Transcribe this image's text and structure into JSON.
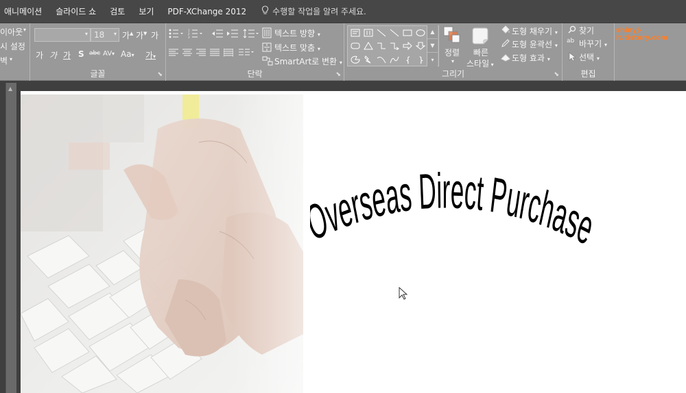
{
  "menubar": {
    "tabs": [
      "애니메이션",
      "슬라이드 쇼",
      "검토",
      "보기",
      "PDF-XChange 2012"
    ],
    "tell_me": "수행할 작업을 알려 주세요."
  },
  "ribbon": {
    "layout_partial": {
      "items": [
        "이아웃",
        "시 설정",
        "벽"
      ]
    },
    "font": {
      "label": "글꼴",
      "size": "18",
      "grow": "가",
      "shrink": "가",
      "clear": "가",
      "bold": "가",
      "italic": "가",
      "underline": "가",
      "shadow": "S",
      "strike": "abc",
      "spacing": "AV",
      "case": "Aa",
      "color": "가"
    },
    "paragraph": {
      "label": "단락",
      "text_direction": "텍스트 방향",
      "align_text": "텍스트 맞춤",
      "smartart": "SmartArt로 변환"
    },
    "drawing": {
      "label": "그리기",
      "arrange": "정렬",
      "quick_styles_1": "빠른",
      "quick_styles_2": "스타일",
      "shape_fill": "도형 채우기",
      "shape_outline": "도형 윤곽선",
      "shape_effects": "도형 효과"
    },
    "editing": {
      "label": "편집",
      "find": "찾기",
      "replace": "바꾸기",
      "select": "선택"
    }
  },
  "watermark": "shinyj-it.tistory.com",
  "slide": {
    "wordart_text": "Overseas Direct Purchase"
  }
}
